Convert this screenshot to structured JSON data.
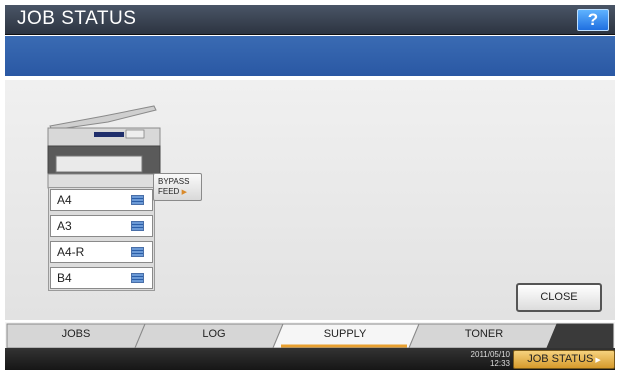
{
  "window": {
    "title": "JOB STATUS",
    "help_label": "?"
  },
  "supply": {
    "drawers": [
      {
        "label": "A4"
      },
      {
        "label": "A3"
      },
      {
        "label": "A4-R"
      },
      {
        "label": "B4"
      }
    ],
    "bypass": {
      "line1": "BYPASS",
      "line2": "FEED",
      "arrow": "▶"
    }
  },
  "buttons": {
    "close_label": "CLOSE",
    "job_status_label": "JOB STATUS",
    "job_status_arrow": "▶"
  },
  "tabs": [
    {
      "label": "JOBS",
      "active": false
    },
    {
      "label": "LOG",
      "active": false
    },
    {
      "label": "SUPPLY",
      "active": true
    },
    {
      "label": "TONER",
      "active": false
    }
  ],
  "status_bar": {
    "date": "2011/05/10",
    "time": "12:33"
  },
  "colors": {
    "title_bar": "#2c3441",
    "message_band": "#2a58a4",
    "help_button": "#1f6fe0",
    "active_tab_accent": "#e8a030",
    "job_status_button": "#d69a2c"
  }
}
